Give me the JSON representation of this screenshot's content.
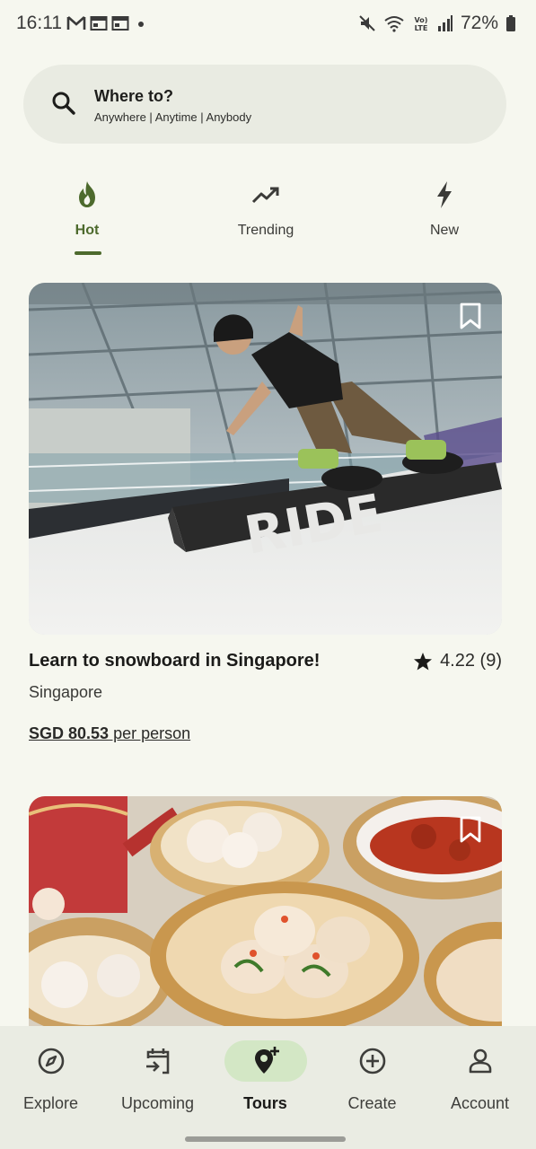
{
  "status_bar": {
    "time": "16:11",
    "battery": "72%",
    "left_icons": [
      "gmail-icon",
      "calendar-icon",
      "calendar-icon",
      "dot-icon"
    ],
    "right_icons": [
      "mute-icon",
      "wifi-icon",
      "volte-icon",
      "signal-icon",
      "battery-icon"
    ]
  },
  "search": {
    "title": "Where to?",
    "subtitle": "Anywhere | Anytime | Anybody"
  },
  "tabs": [
    {
      "label": "Hot",
      "icon": "flame-icon",
      "active": true
    },
    {
      "label": "Trending",
      "icon": "trending-icon",
      "active": false
    },
    {
      "label": "New",
      "icon": "bolt-icon",
      "active": false
    }
  ],
  "listings": [
    {
      "title": "Learn to snowboard in Singapore!",
      "rating": "4.22 (9)",
      "location": "Singapore",
      "price": "SGD 80.53",
      "price_suffix": " per person",
      "board_text": "RIDE"
    },
    {}
  ],
  "bottom_nav": [
    {
      "label": "Explore",
      "icon": "compass-icon",
      "active": false
    },
    {
      "label": "Upcoming",
      "icon": "calendar-arrow-icon",
      "active": false
    },
    {
      "label": "Tours",
      "icon": "map-pin-add-icon",
      "active": true
    },
    {
      "label": "Create",
      "icon": "plus-circle-icon",
      "active": false
    },
    {
      "label": "Account",
      "icon": "person-icon",
      "active": false
    }
  ],
  "colors": {
    "background": "#f6f7ef",
    "accent": "#4d6a2d",
    "active_pill": "#d3e7c5",
    "nav_background": "#eaece3"
  }
}
